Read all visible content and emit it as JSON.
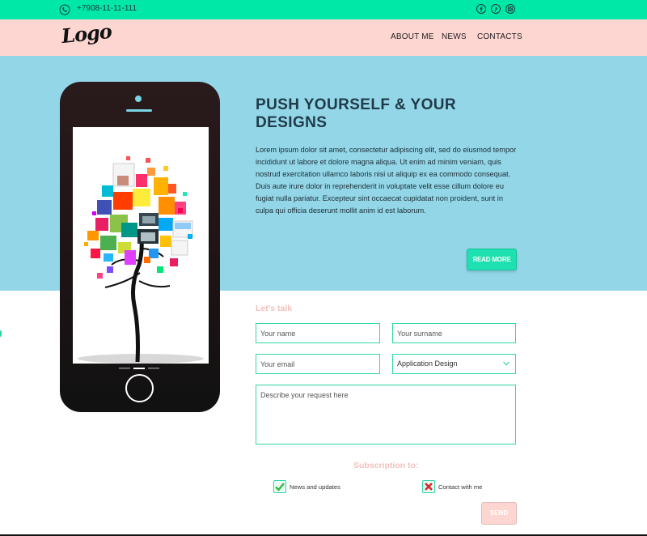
{
  "topbar": {
    "phone_icon": "phone-icon",
    "phone_number": "+7908-11-11-111",
    "social_icons": [
      "facebook-icon",
      "pinterest-icon",
      "instagram-icon"
    ],
    "accent_color": "#00e8a8"
  },
  "header": {
    "logo_text": "Logo",
    "nav": [
      "ABOUT ME",
      "NEWS",
      "CONTACTS"
    ],
    "background": "#fdd6d2"
  },
  "hero": {
    "title": "PUSH YOURSELF & YOUR DESIGNS",
    "text": "Lorem ipsum dolor sit amet, consectetur adipiscing elit, sed do eiusmod tempor incididunt ut labore et dolore magna aliqua. Ut enim ad minim veniam, quis nostrud exercitation ullamco laboris nisi ut aliquip ex ea commodo consequat. Duis aute irure dolor in reprehenderit in voluptate velit esse cillum dolore eu fugiat nulla pariatur. Excepteur sint occaecat cupidatat non proident, sunt in culpa qui officia deserunt mollit anim id est laborum.",
    "read_more": "READ MORE",
    "background": "#92d6e8"
  },
  "form": {
    "heading": "Let's talk",
    "name_placeholder": "Your name",
    "surname_placeholder": "Your surname",
    "email_placeholder": "Your email",
    "service_selected": "Application Design",
    "request_placeholder": "Describe your request here",
    "subscription_heading": "Subscription to:",
    "options": [
      {
        "label": "News and updates",
        "state": "checked",
        "icon": "checkmark-icon"
      },
      {
        "label": "Contact with me",
        "state": "unchecked",
        "icon": "cross-icon"
      }
    ],
    "send": "SEND"
  }
}
